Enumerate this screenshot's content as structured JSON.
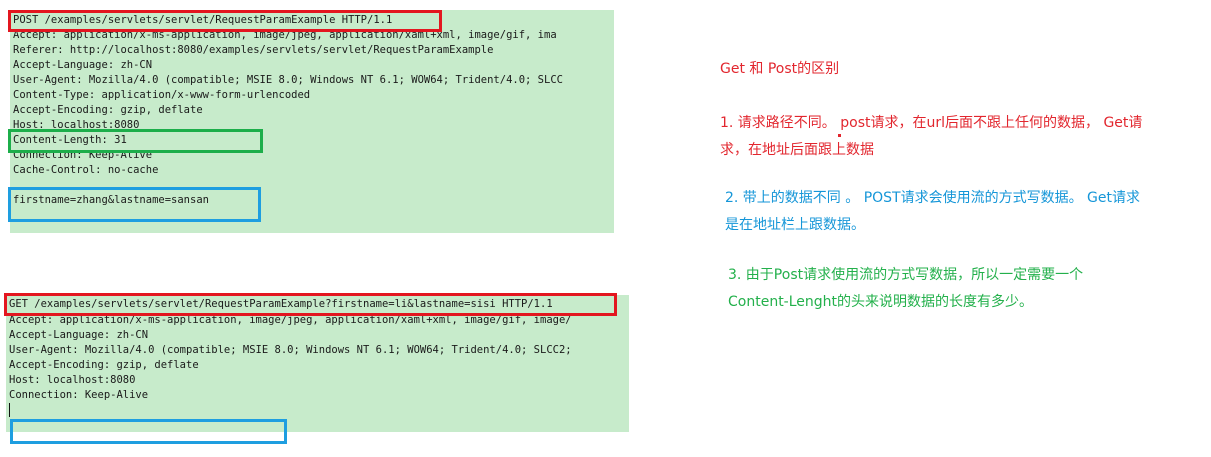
{
  "post_request": {
    "lines": [
      "POST /examples/servlets/servlet/RequestParamExample HTTP/1.1",
      "Accept: application/x-ms-application, image/jpeg, application/xaml+xml, image/gif, ima",
      "Referer: http://localhost:8080/examples/servlets/servlet/RequestParamExample",
      "Accept-Language: zh-CN",
      "User-Agent: Mozilla/4.0 (compatible; MSIE 8.0; Windows NT 6.1; WOW64; Trident/4.0; SLCC",
      "Content-Type: application/x-www-form-urlencoded",
      "Accept-Encoding: gzip, deflate",
      "Host: localhost:8080",
      "Content-Length: 31",
      "Connection: Keep-Alive",
      "Cache-Control: no-cache",
      "",
      "firstname=zhang&lastname=sansan"
    ]
  },
  "get_request": {
    "lines": [
      "GET /examples/servlets/servlet/RequestParamExample?firstname=li&lastname=sisi HTTP/1.1",
      "Accept: application/x-ms-application, image/jpeg, application/xaml+xml, image/gif, image/",
      "Accept-Language: zh-CN",
      "User-Agent: Mozilla/4.0 (compatible; MSIE 8.0; Windows NT 6.1; WOW64; Trident/4.0; SLCC2;",
      "Accept-Encoding: gzip, deflate",
      "Host: localhost:8080",
      "Connection: Keep-Alive"
    ]
  },
  "notes": {
    "title": "Get 和 Post的区别",
    "point1_line1": "1. 请求路径不同。  post请求，在url后面不跟上任何的数据，  Get请",
    "point1_line2": "求，在地址后面跟上数据",
    "point2_line1": "2. 带上的数据不同  。  POST请求会使用流的方式写数据。  Get请求",
    "point2_line2": "是在地址栏上跟数据。",
    "point3_line1": "3. 由于Post请求使用流的方式写数据，所以一定需要一个",
    "point3_line2": "Content-Lenght的头来说明数据的长度有多少。"
  },
  "colors": {
    "panel_bg": "#c7ebcb",
    "highlight_red": "#e3161f",
    "highlight_green": "#1cae4a",
    "highlight_blue": "#1e9ee0",
    "note_red": "#e2262e",
    "note_blue": "#1596d8",
    "note_green": "#23b04b"
  }
}
